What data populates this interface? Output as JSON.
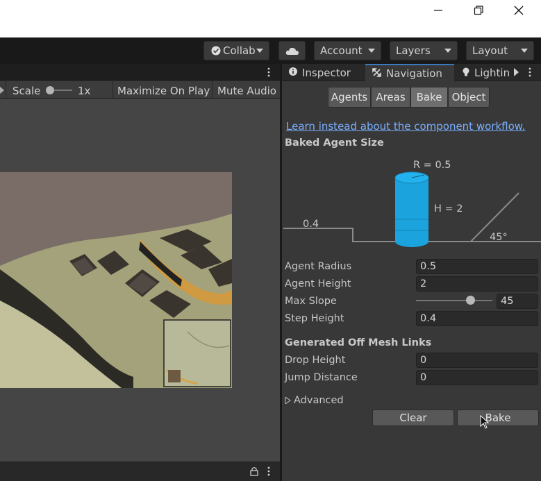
{
  "window": {
    "minimize_icon": "minimize-icon",
    "maximize_icon": "restore-icon",
    "close_icon": "close-icon"
  },
  "toolbar": {
    "collab": "Collab",
    "account": "Account",
    "layers": "Layers",
    "layout": "Layout"
  },
  "game_view": {
    "scale_label": "Scale",
    "scale_value": "1x",
    "maximize_on_play": "Maximize On Play",
    "mute_audio": "Mute Audio"
  },
  "panel": {
    "tabs": [
      {
        "label": "Inspector",
        "icon": "info-icon"
      },
      {
        "label": "Navigation",
        "icon": "navigation-icon"
      },
      {
        "label": "Lightin",
        "icon": "lightbulb-icon"
      }
    ],
    "segments": [
      "Agents",
      "Areas",
      "Bake",
      "Object"
    ],
    "active_segment": "Bake",
    "component_link": "Learn instead about the component workflow.",
    "baked_agent_size": {
      "title": "Baked Agent Size",
      "radius_label": "R = 0.5",
      "height_label": "H = 2",
      "step_label": "0.4",
      "slope_label": "45°"
    },
    "fields": {
      "agent_radius_label": "Agent Radius",
      "agent_radius": "0.5",
      "agent_height_label": "Agent Height",
      "agent_height": "2",
      "max_slope_label": "Max Slope",
      "max_slope": "45",
      "step_height_label": "Step Height",
      "step_height": "0.4"
    },
    "offmesh": {
      "title": "Generated Off Mesh Links",
      "drop_height_label": "Drop Height",
      "drop_height": "0",
      "jump_distance_label": "Jump Distance",
      "jump_distance": "0"
    },
    "advanced_label": "Advanced",
    "clear_label": "Clear",
    "bake_label": "Bake"
  },
  "colors": {
    "accent": "#3a79bb",
    "link": "#7ab0ff",
    "cylinder": "#1aa3dc"
  }
}
